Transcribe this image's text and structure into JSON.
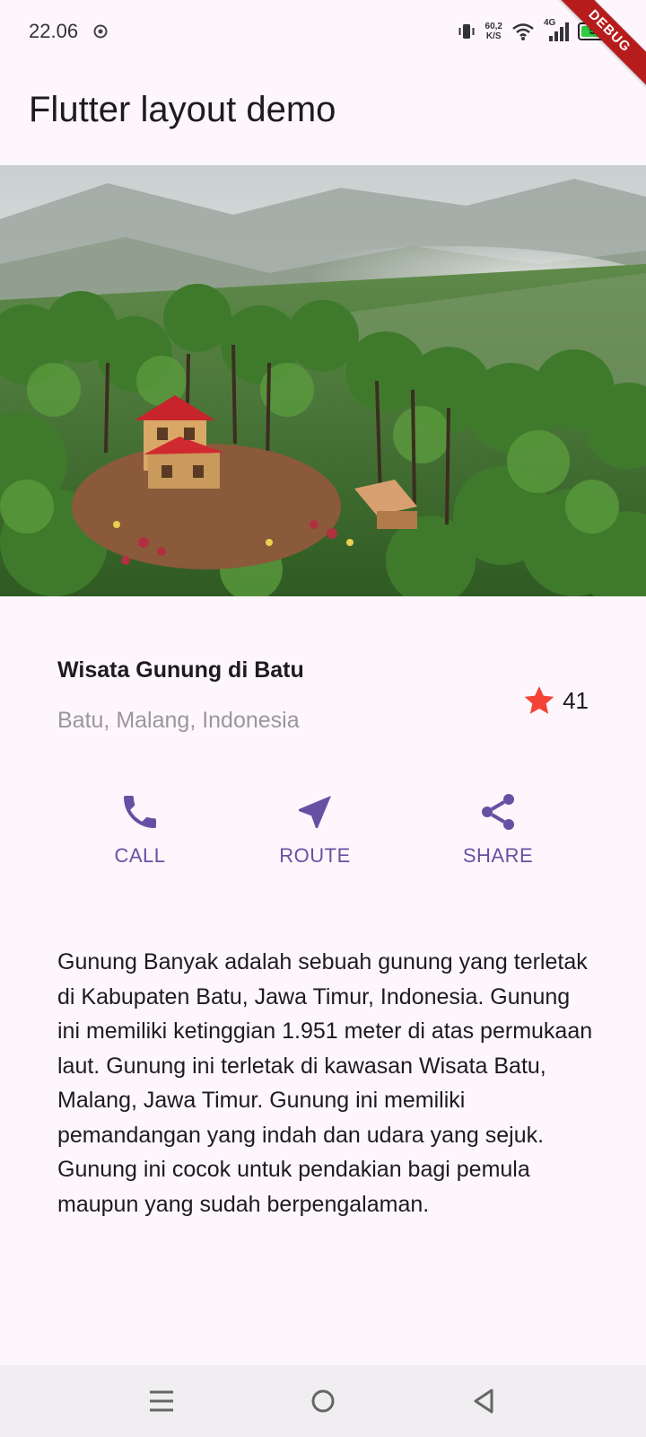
{
  "status_bar": {
    "time": "22.06",
    "net_speed_value": "60,2",
    "net_speed_unit": "K/S",
    "network_type": "4G",
    "battery_level": "55",
    "debug_banner": "DEBUG"
  },
  "app_bar": {
    "title": "Flutter layout demo"
  },
  "hero": {
    "image_subject": "mountain forest with red-roof tree house"
  },
  "title_section": {
    "name": "Wisata Gunung di Batu",
    "location": "Batu, Malang, Indonesia",
    "rating_count": "41",
    "star_color": "#f44336"
  },
  "actions": [
    {
      "label": "CALL",
      "icon": "phone-icon"
    },
    {
      "label": "ROUTE",
      "icon": "navigation-icon"
    },
    {
      "label": "SHARE",
      "icon": "share-icon"
    }
  ],
  "accent_color": "#6750a4",
  "description": "Gunung Banyak adalah sebuah gunung yang terletak di Kabupaten Batu, Jawa Timur, Indonesia. Gunung ini memiliki ketinggian 1.951 meter di atas permukaan laut. Gunung ini terletak di kawasan Wisata Batu, Malang, Jawa Timur. Gunung ini memiliki pemandangan yang indah dan udara yang sejuk. Gunung ini cocok untuk pendakian bagi pemula maupun yang sudah berpengalaman.",
  "nav_bar": {
    "buttons": [
      "menu",
      "home",
      "back"
    ]
  }
}
